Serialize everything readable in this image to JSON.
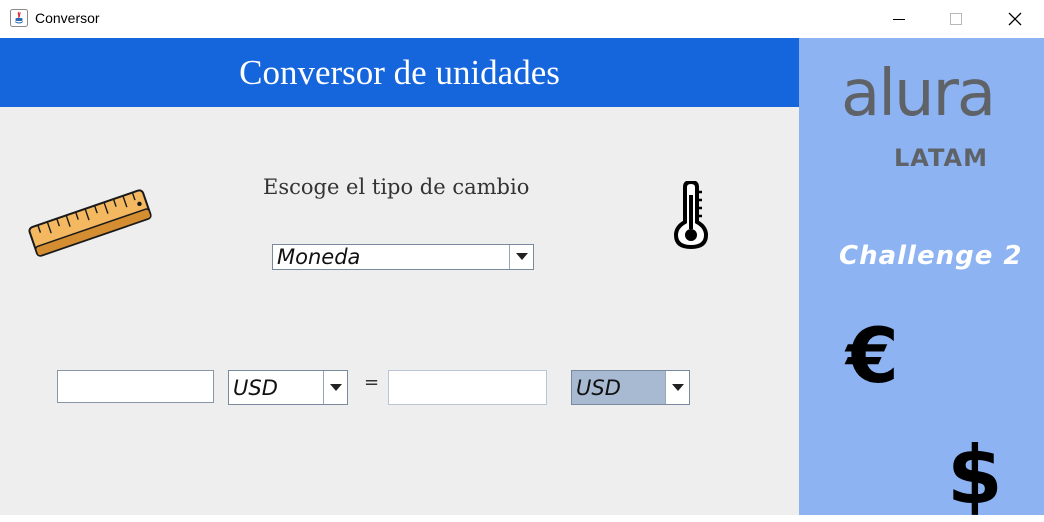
{
  "window": {
    "title": "Conversor",
    "controls": {
      "minimize": "minimize-icon",
      "maximize": "maximize-icon",
      "close": "close-icon"
    }
  },
  "header": {
    "title": "Conversor de unidades"
  },
  "main": {
    "subtitle": "Escoge el tipo de cambio",
    "type_select": {
      "value": "Moneda"
    },
    "converter": {
      "from_value": "",
      "from_unit": "USD",
      "equals": "=",
      "to_value": "",
      "to_unit": "USD"
    },
    "icons": [
      "ruler-icon",
      "thermometer-icon"
    ]
  },
  "sidebar": {
    "logo": {
      "brand": "alura",
      "region": "LATAM"
    },
    "challenge": "Challenge 2",
    "currency_symbols": [
      "€",
      "$"
    ]
  },
  "colors": {
    "banner": "#1565dc",
    "sidebar": "#8db3f3",
    "panel": "#eeeeee",
    "logo_gray": "#5f6368",
    "selected_combo": "#a7bad1"
  }
}
